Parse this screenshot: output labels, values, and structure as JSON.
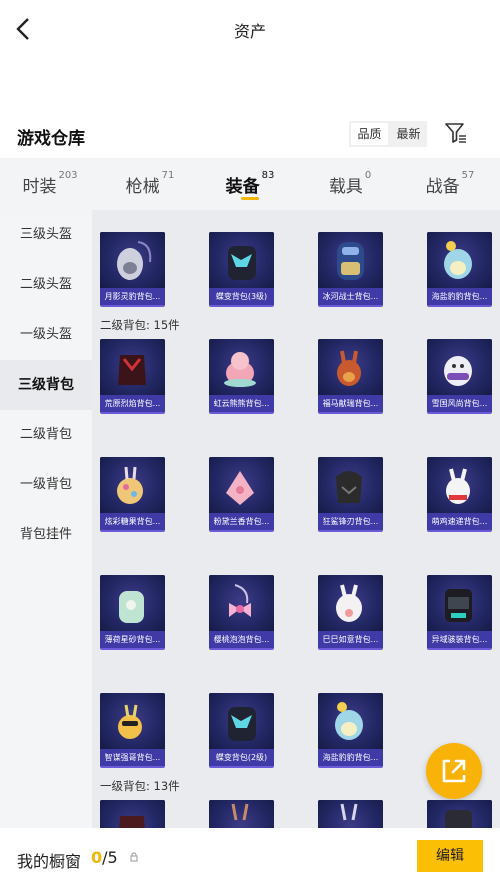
{
  "header": {
    "title": "资产",
    "back_icon": "chevron-left-icon"
  },
  "section": {
    "title": "游戏仓库",
    "sort_options": [
      "品质",
      "最新"
    ],
    "sort_active": "品质",
    "filter_icon": "filter-icon"
  },
  "tabs": [
    {
      "label": "时装",
      "count": "203"
    },
    {
      "label": "枪械",
      "count": "71"
    },
    {
      "label": "装备",
      "count": "83",
      "active": true
    },
    {
      "label": "载具",
      "count": "0"
    },
    {
      "label": "战备",
      "count": "57"
    }
  ],
  "sidebar": {
    "items": [
      "三级头盔",
      "二级头盔",
      "一级头盔",
      "三级背包",
      "二级背包",
      "一级背包",
      "背包挂件"
    ],
    "active": "三级背包"
  },
  "groups": {
    "level2_label": "二级背包: 15件",
    "level1_label": "一级背包: 13件"
  },
  "cards": {
    "row0": [
      "月影灵豹背包...",
      "蝶变背包(3级)",
      "冰河战士背包...",
      "海盐豹豹背包..."
    ],
    "row1": [
      "荒原烈焰背包...",
      "虹云熊熊背包...",
      "福马献瑞背包...",
      "雪国风尚背包..."
    ],
    "row2": [
      "炫彩糖果背包...",
      "粉黛兰香背包...",
      "狂鲨锋刃背包...",
      "萌鸡速递背包..."
    ],
    "row3": [
      "薄荷星砂背包...",
      "樱桃泡泡背包...",
      "巳巳如意背包...",
      "异域骇装背包..."
    ],
    "row4": [
      "智谋强哥背包...",
      "蝶变背包(2级)",
      "海盐豹豹背包..."
    ]
  },
  "bottom": {
    "wardrobe_label": "我的橱窗",
    "wardrobe_used": "0",
    "wardrobe_total": "/5",
    "edit_label": "编辑"
  },
  "colors": {
    "accent": "#f2b705",
    "card_bg": "#1a1f52",
    "card_label_bg": "#3f3aa6"
  }
}
